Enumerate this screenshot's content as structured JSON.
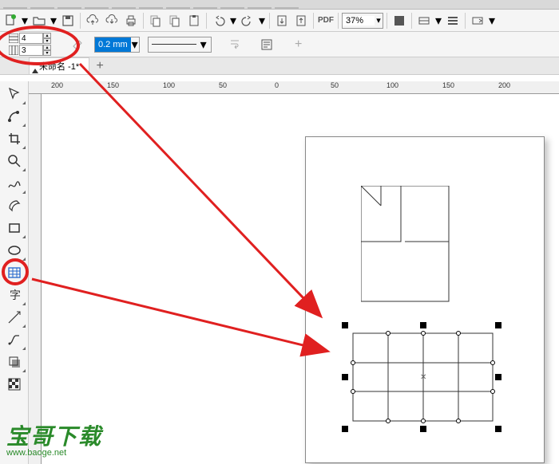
{
  "toolbar": {
    "zoom": "37%",
    "pdf_label": "PDF"
  },
  "propbar": {
    "rows": "4",
    "cols": "3",
    "outline_width": "0.2 mm"
  },
  "doc": {
    "tab_name": "未命名 -1*",
    "add_tab": "+"
  },
  "ruler": {
    "h_ticks": [
      "200",
      "150",
      "100",
      "50",
      "0",
      "50",
      "100",
      "150",
      "200"
    ],
    "h_positions": [
      65,
      115,
      165,
      215,
      265,
      315,
      365,
      415,
      465
    ]
  },
  "watermark": {
    "title": "宝哥下载",
    "url": "www.baoge.net"
  }
}
